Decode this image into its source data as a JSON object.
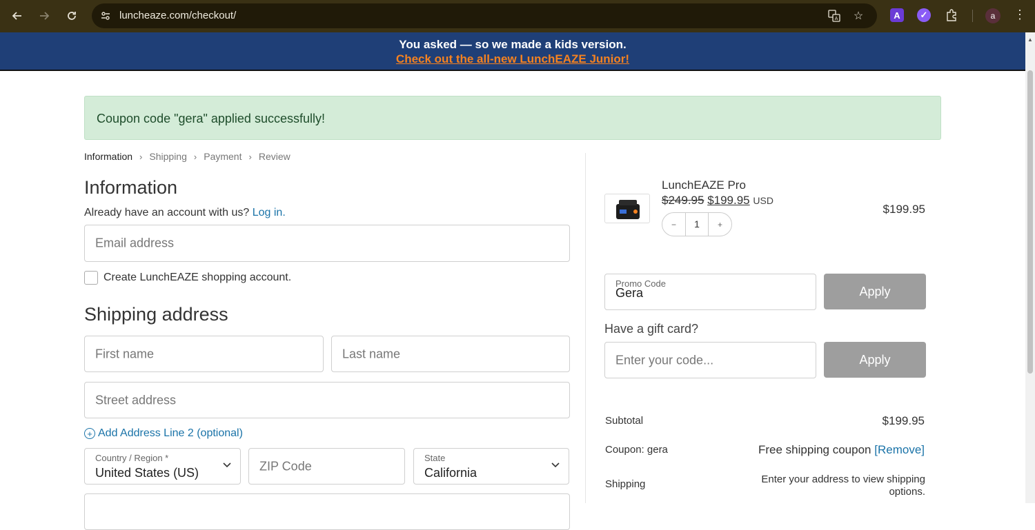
{
  "browser": {
    "url": "luncheaze.com/checkout/",
    "avatar_letter": "a",
    "ext_a_letter": "A"
  },
  "banner": {
    "line1": "You asked — so we made a kids version.",
    "line2": "Check out the all-new LunchEAZE Junior!"
  },
  "notice": {
    "message": "Coupon code \"gera\" applied successfully!"
  },
  "breadcrumbs": [
    "Information",
    "Shipping",
    "Payment",
    "Review"
  ],
  "information": {
    "heading": "Information",
    "account_prompt": "Already have an account with us?",
    "login_link": "Log in.",
    "email_placeholder": "Email address",
    "create_account_label": "Create LunchEAZE shopping account."
  },
  "shipping": {
    "heading": "Shipping address",
    "first_name_placeholder": "First name",
    "last_name_placeholder": "Last name",
    "street_placeholder": "Street address",
    "add_line2": "Add Address Line 2 (optional)",
    "country_label": "Country / Region *",
    "country_value": "United States (US)",
    "zip_placeholder": "ZIP Code",
    "state_label": "State",
    "state_value": "California"
  },
  "cart": {
    "product_name": "LunchEAZE Pro",
    "old_price": "$249.95",
    "new_price": "$199.95",
    "currency": "USD",
    "line_total": "$199.95",
    "quantity": "1",
    "minus": "−",
    "plus": "+"
  },
  "promo": {
    "label": "Promo Code",
    "value": "Gera",
    "apply": "Apply"
  },
  "gift": {
    "question": "Have a gift card?",
    "placeholder": "Enter your code...",
    "apply": "Apply"
  },
  "summary": {
    "subtotal_label": "Subtotal",
    "subtotal_value": "$199.95",
    "coupon_label": "Coupon: gera",
    "coupon_value": "Free shipping coupon",
    "remove_link": "[Remove]",
    "shipping_label": "Shipping",
    "shipping_note": "Enter your address to view shipping options."
  },
  "colors": {
    "banner_bg": "#1f3f77",
    "banner_link": "#f58220",
    "notice_bg": "#d4ecd8",
    "link": "#1a73a8",
    "apply_button": "#9e9e9e"
  }
}
